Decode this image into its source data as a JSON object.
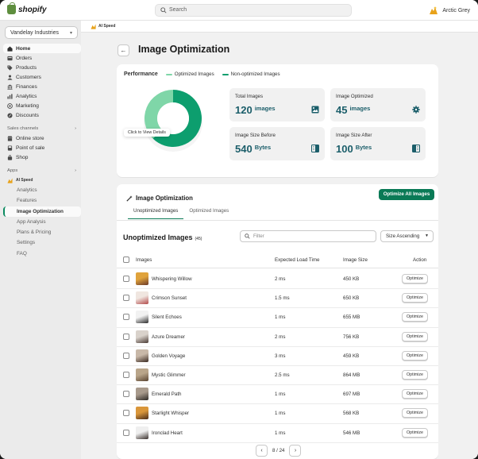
{
  "topbar": {
    "brand": "shopify",
    "search_placeholder": "Search",
    "user_name": "Arctic Grey"
  },
  "sidebar": {
    "store": "Vandelay Industries",
    "items": [
      {
        "label": "Home",
        "icon": "home-icon",
        "active": true
      },
      {
        "label": "Orders",
        "icon": "orders-icon"
      },
      {
        "label": "Products",
        "icon": "tag-icon"
      },
      {
        "label": "Customers",
        "icon": "person-icon"
      },
      {
        "label": "Finances",
        "icon": "bank-icon"
      },
      {
        "label": "Analytics",
        "icon": "chart-icon"
      },
      {
        "label": "Marketing",
        "icon": "target-icon"
      },
      {
        "label": "Discounts",
        "icon": "discount-icon"
      }
    ],
    "sales_channels_label": "Sales channels",
    "channels": [
      {
        "label": "Online store",
        "icon": "store-icon"
      },
      {
        "label": "Point of sale",
        "icon": "pos-icon"
      },
      {
        "label": "Shop",
        "icon": "bag-icon"
      }
    ],
    "apps_label": "Apps",
    "app_name": "AI Speed",
    "app_items": [
      "Analytics",
      "Features",
      "Image Optimization",
      "App Analysis",
      "Plans & Pricing",
      "Settings",
      "FAQ"
    ]
  },
  "appbar": {
    "name": "AI Speed"
  },
  "page": {
    "title": "Image Optimization"
  },
  "performance": {
    "title": "Performance",
    "legend_optimized": "Optimized Images",
    "legend_non_optimized": "Non-optimized Images",
    "tooltip": "Click to View Details",
    "colors": {
      "optimized": "#7fd6a8",
      "non_optimized": "#0d9e6e"
    },
    "optimized_fraction": 0.375,
    "stats": [
      {
        "label": "Total Images",
        "value": "120",
        "unit": "images",
        "icon": "image-icon"
      },
      {
        "label": "Image Optimized",
        "value": "45",
        "unit": "images",
        "icon": "gear-icon"
      },
      {
        "label": "Image Size Before",
        "value": "540",
        "unit": "Bytes",
        "icon": "compress-icon"
      },
      {
        "label": "Image Size After",
        "value": "100",
        "unit": "Bytes",
        "icon": "compress-icon"
      }
    ]
  },
  "optimization": {
    "title": "Image Optimization",
    "optimize_all": "Optimize All Images",
    "tabs": [
      "Unoptimized Images",
      "Optimized Images"
    ],
    "table_title": "Unoptimized Images",
    "count": "(45)",
    "filter_placeholder": "Filter",
    "sort": "Size Ascending",
    "columns": {
      "images": "Images",
      "load_time": "Expected Load Time",
      "size": "Image Size",
      "action": "Action"
    },
    "rows": [
      {
        "name": "Whispering Willow",
        "load": "2 ms",
        "size": "450 KB",
        "action": "Optimize",
        "c1": "#e0a33c",
        "c2": "#6b3a2a"
      },
      {
        "name": "Crimson Sunset",
        "load": "1.5 ms",
        "size": "650 KB",
        "action": "Optimize",
        "c1": "#f0e6e0",
        "c2": "#b24a4a"
      },
      {
        "name": "Silent Echoes",
        "load": "1 ms",
        "size": "655 MB",
        "action": "Optimize",
        "c1": "#f2f2f2",
        "c2": "#2b2b2b"
      },
      {
        "name": "Azure Dreamer",
        "load": "2 ms",
        "size": "756 KB",
        "action": "Optimize",
        "c1": "#d9d2cb",
        "c2": "#4a3b35"
      },
      {
        "name": "Golden Voyage",
        "load": "3 ms",
        "size": "459 KB",
        "action": "Optimize",
        "c1": "#c8b8a8",
        "c2": "#3b2a22"
      },
      {
        "name": "Mystic Glimmer",
        "load": "2.5 ms",
        "size": "864 MB",
        "action": "Optimize",
        "c1": "#b9a58a",
        "c2": "#5a4532"
      },
      {
        "name": "Emerald Path",
        "load": "1 ms",
        "size": "697 MB",
        "action": "Optimize",
        "c1": "#a89a8c",
        "c2": "#2e2a26"
      },
      {
        "name": "Starlight Whisper",
        "load": "1 ms",
        "size": "568 KB",
        "action": "Optimize",
        "c1": "#d9963a",
        "c2": "#4a2c1a"
      },
      {
        "name": "Ironclad Heart",
        "load": "1 ms",
        "size": "546 MB",
        "action": "Optimize",
        "c1": "#efefef",
        "c2": "#3a302c"
      }
    ],
    "pagination": "8 / 24"
  }
}
